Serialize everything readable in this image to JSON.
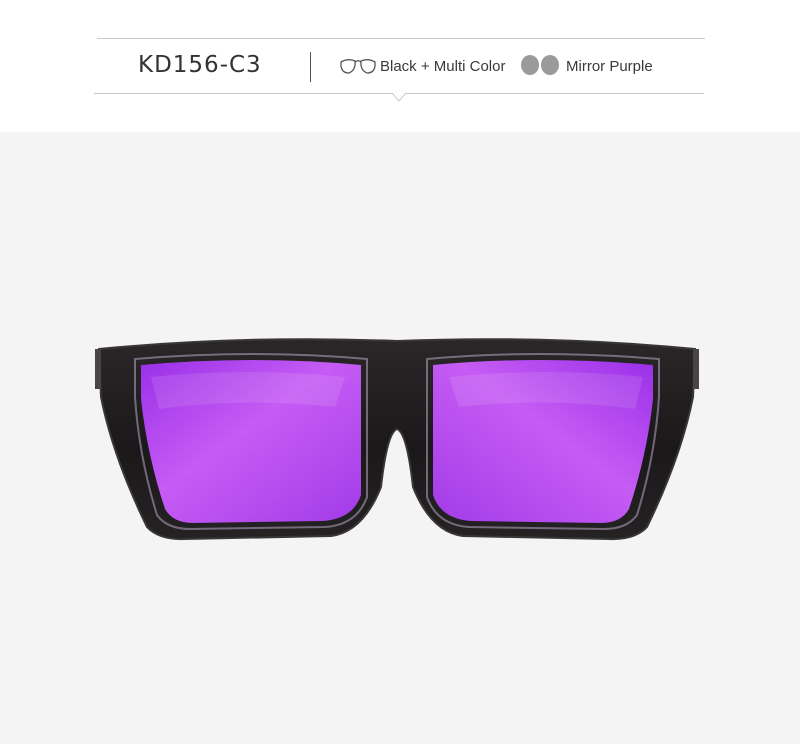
{
  "header": {
    "model_code": "KD156-C3",
    "frame_color_label": "Black + Multi Color",
    "lens_color_label": "Mirror Purple"
  },
  "icons": {
    "frame": "glasses-outline-icon",
    "lens": "lens-pair-icon"
  },
  "colors": {
    "background": "#f4f4f4",
    "frame": "#1c1a1b",
    "lens": "#b84ff0",
    "rule": "#c9c9c9"
  }
}
